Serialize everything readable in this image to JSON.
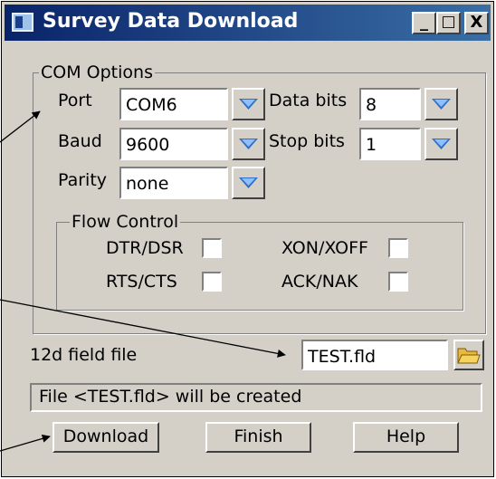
{
  "window": {
    "title": "Survey Data Download",
    "minimize": "_",
    "maximize": "□",
    "close": "X"
  },
  "com_options": {
    "legend": "COM Options",
    "port": {
      "label": "Port",
      "value": "COM6"
    },
    "baud": {
      "label": "Baud",
      "value": "9600"
    },
    "parity": {
      "label": "Parity",
      "value": "none"
    },
    "data_bits": {
      "label": "Data bits",
      "value": "8"
    },
    "stop_bits": {
      "label": "Stop bits",
      "value": "1"
    }
  },
  "flow_control": {
    "legend": "Flow Control",
    "dtr_dsr": {
      "label": "DTR/DSR",
      "checked": false
    },
    "xon_xoff": {
      "label": "XON/XOFF",
      "checked": false
    },
    "rts_cts": {
      "label": "RTS/CTS",
      "checked": false
    },
    "ack_nak": {
      "label": "ACK/NAK",
      "checked": false
    }
  },
  "field_file": {
    "label": "12d field file",
    "value": "TEST.fld"
  },
  "status_text": "File <TEST.fld> will be created",
  "buttons": {
    "download": "Download",
    "finish": "Finish",
    "help": "Help"
  },
  "colors": {
    "face": "#d4d0c8",
    "title_start": "#0a246a",
    "title_end": "#3a6ea5",
    "drop_arrow": "#2f6fc5"
  },
  "icons": {
    "combo": "chevron-down-icon",
    "folder": "folder-icon",
    "app": "app-window-icon"
  }
}
